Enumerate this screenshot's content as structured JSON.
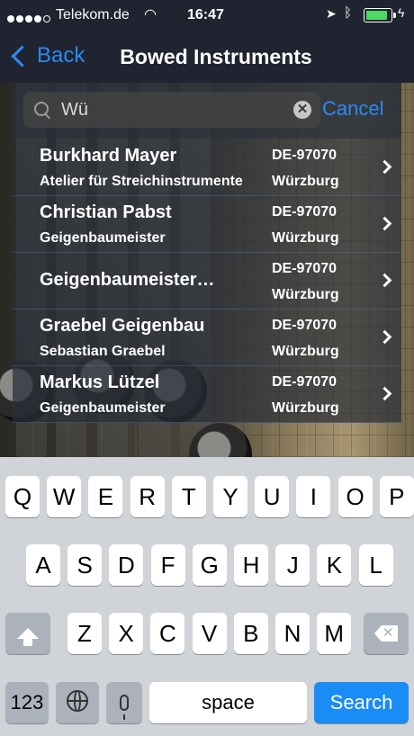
{
  "status_bar": {
    "carrier": "Telekom.de",
    "time": "16:47",
    "signal_dots_filled": 4,
    "signal_dots_total": 5,
    "battery_level": 0.95
  },
  "nav": {
    "back_label": "Back",
    "title": "Bowed Instruments"
  },
  "search": {
    "query": "Wü",
    "cancel_label": "Cancel"
  },
  "results": [
    {
      "name": "Burkhard Mayer",
      "subtitle": "Atelier für Streichinstrumente",
      "zip": "DE-97070",
      "city": "Würzburg"
    },
    {
      "name": "Christian Pabst",
      "subtitle": "Geigenbaumeister",
      "zip": "DE-97070",
      "city": "Würzburg"
    },
    {
      "name": "Geigenbaumeister…",
      "subtitle": "",
      "zip": "DE-97070",
      "city": "Würzburg"
    },
    {
      "name": "Graebel Geigenbau",
      "subtitle": "Sebastian Graebel",
      "zip": "DE-97070",
      "city": "Würzburg"
    },
    {
      "name": "Markus Lützel",
      "subtitle": "Geigenbaumeister",
      "zip": "DE-97070",
      "city": "Würzburg"
    }
  ],
  "keyboard": {
    "row1": [
      "Q",
      "W",
      "E",
      "R",
      "T",
      "Y",
      "U",
      "I",
      "O",
      "P"
    ],
    "row2": [
      "A",
      "S",
      "D",
      "F",
      "G",
      "H",
      "J",
      "K",
      "L"
    ],
    "row3": [
      "Z",
      "X",
      "C",
      "V",
      "B",
      "N",
      "M"
    ],
    "numbers_label": "123",
    "space_label": "space",
    "search_label": "Search"
  },
  "colors": {
    "accent": "#2a8af5",
    "bar_background": "#1f2430",
    "search_key": "#1a8cf6",
    "battery": "#4cd964"
  }
}
